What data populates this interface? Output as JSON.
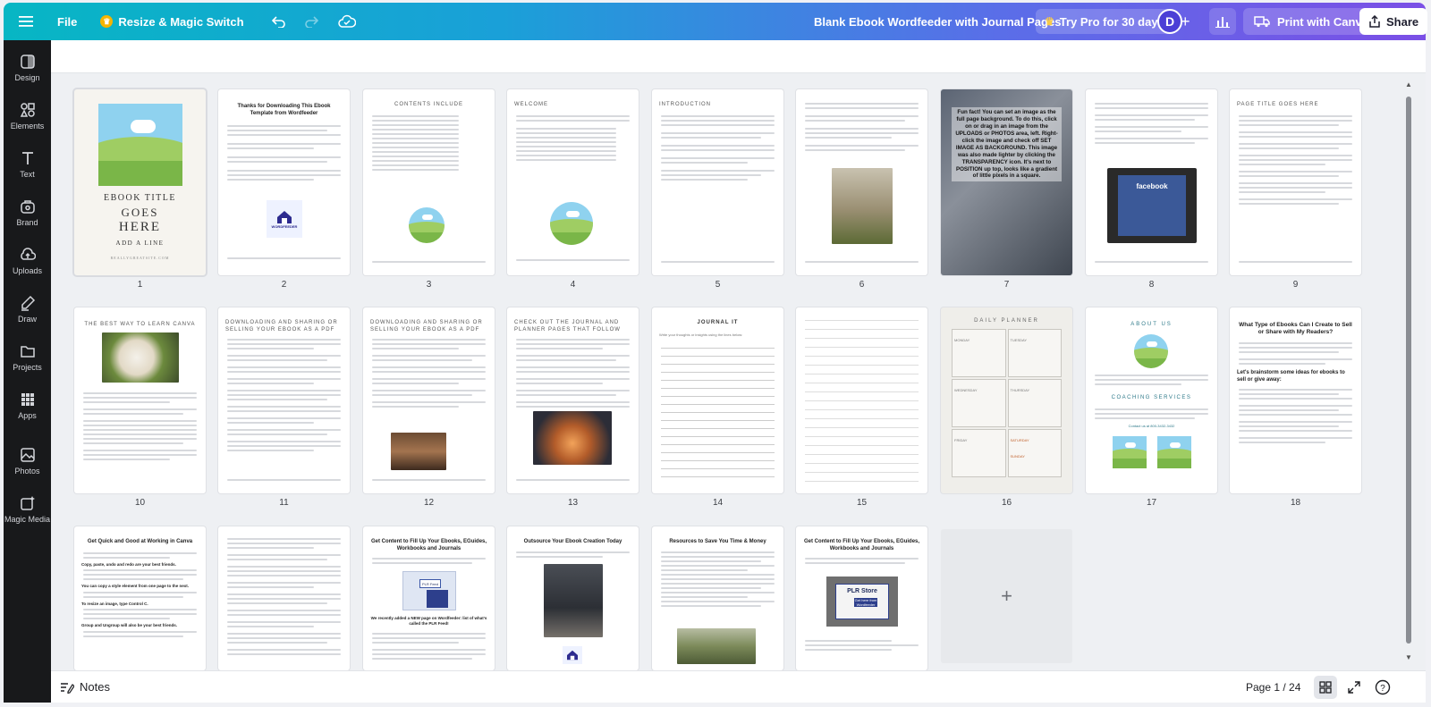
{
  "topbar": {
    "file_label": "File",
    "resize_label": "Resize & Magic Switch",
    "doc_title": "Blank Ebook Wordfeeder with Journal Pages",
    "try_pro_label": "Try Pro for 30 days",
    "avatar_letter": "D",
    "plus_label": "+",
    "print_label": "Print with Canva",
    "share_label": "Share"
  },
  "sidebar": {
    "items": [
      {
        "label": "Design",
        "icon": "design-icon"
      },
      {
        "label": "Elements",
        "icon": "elements-icon"
      },
      {
        "label": "Text",
        "icon": "text-icon"
      },
      {
        "label": "Brand",
        "icon": "brand-icon"
      },
      {
        "label": "Uploads",
        "icon": "uploads-icon"
      },
      {
        "label": "Draw",
        "icon": "draw-icon"
      },
      {
        "label": "Projects",
        "icon": "projects-icon"
      },
      {
        "label": "Apps",
        "icon": "apps-icon"
      },
      {
        "label": "Photos",
        "icon": "photos-icon"
      },
      {
        "label": "Magic Media",
        "icon": "magic-media-icon"
      }
    ]
  },
  "pages": {
    "numbers": [
      "1",
      "2",
      "3",
      "4",
      "5",
      "6",
      "7",
      "8",
      "9",
      "10",
      "11",
      "12",
      "13",
      "14",
      "15",
      "16",
      "17",
      "18"
    ],
    "p1": {
      "title_line1": "EBOOK TITLE",
      "title_line2": "GOES",
      "title_line3": "HERE",
      "subtitle": "ADD A LINE",
      "footer": "REALLYGREATSITE.COM"
    },
    "p2": {
      "title": "Thanks for Downloading This Ebook Template from Wordfeeder",
      "logo": "WORDFEEDER"
    },
    "p3": {
      "title": "CONTENTS INCLUDE"
    },
    "p4": {
      "title": "WELCOME"
    },
    "p5": {
      "title": "INTRODUCTION"
    },
    "p7": {
      "text": "Fun fact! You can set an image as the full page background. To do this, click on or drag in an image from the UPLOADS or PHOTOS area, left. Right-click the image and check off SET IMAGE AS BACKGROUND. This image was also made lighter by clicking the TRANSPARENCY icon. It's next to POSITION up top, looks like a gradient of little pixels in a square."
    },
    "p8": {
      "screen_text": "facebook"
    },
    "p9": {
      "title": "PAGE TITLE GOES HERE"
    },
    "p10": {
      "title": "THE BEST WAY TO LEARN CANVA"
    },
    "p11": {
      "title": "DOWNLOADING AND SHARING OR SELLING YOUR EBOOK AS A PDF"
    },
    "p12": {
      "title": "DOWNLOADING AND SHARING OR SELLING YOUR EBOOK AS A PDF"
    },
    "p13": {
      "title": "CHECK OUT THE JOURNAL AND PLANNER PAGES THAT FOLLOW"
    },
    "p14": {
      "title": "JOURNAL IT",
      "sub": "Write your thoughts or insights using the lines below:"
    },
    "p16": {
      "title": "DAILY PLANNER",
      "days": [
        "MONDAY",
        "TUESDAY",
        "WEDNESDAY",
        "THURSDAY",
        "FRIDAY",
        "SATURDAY",
        "SUNDAY"
      ]
    },
    "p17": {
      "title": "ABOUT US",
      "coaching": "COACHING SERVICES",
      "contact": "Contact us at 800-3432-3432"
    },
    "p18": {
      "title": "What Type of Ebooks Can I Create to Sell or Share with My Readers?",
      "sub": "Let's brainstorm some ideas for ebooks to sell or give away:"
    },
    "p19": {
      "title": "Get Quick and Good at Working in Canva",
      "h1": "Copy, paste, undo and redo are your best friends.",
      "h2": "You can copy a style element from one page to the next.",
      "h3": "To resize an image, type Control C.",
      "h4": "Group and Ungroup will also be your best friends."
    },
    "p20": {
      "title": ""
    },
    "p21": {
      "title": "Get Content to Fill Up Your Ebooks, EGuides, Workbooks and Journals",
      "badge": "PLR Feed",
      "note": "We recently added a NEW page on Wordfeeder: list of what's called the PLR Feed!"
    },
    "p22": {
      "title": "Outsource Your Ebook Creation Today"
    },
    "p23": {
      "title": "Resources to Save You Time & Money"
    },
    "p24": {
      "title": "Get Content to Fill Up Your Ebooks, EGuides, Workbooks and Journals",
      "badge": "PLR Store",
      "badge_sub": "Get here from Wordfeeder"
    },
    "add_page": "+"
  },
  "footer": {
    "notes_label": "Notes",
    "page_counter": "Page 1 / 24",
    "help_label": "?"
  },
  "colors": {
    "topbar_start": "#07b6c4",
    "topbar_end": "#7b4fe6",
    "sidebar_bg": "#18191b",
    "canvas_bg": "#eef0f3"
  }
}
